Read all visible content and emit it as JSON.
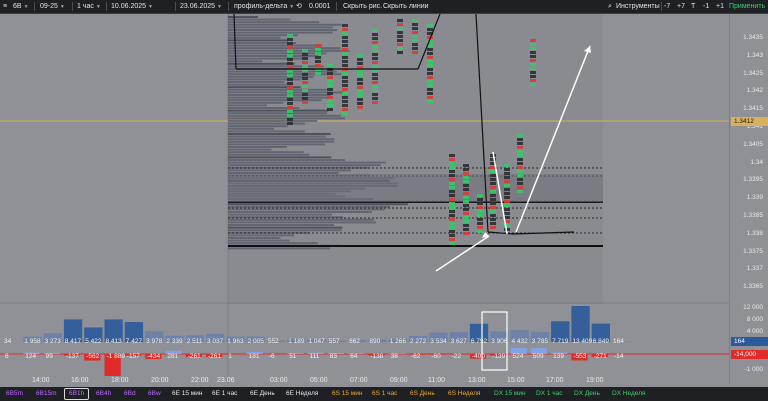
{
  "toolbar": {
    "symbol": "6B",
    "contract": "09-25",
    "interval": "1 час",
    "date_from": "10.06.2025",
    "date_to": "23.06.2025",
    "style": "профиль-дельта",
    "tick_size": "0.0001",
    "hide_levels": "Скрыть рис.",
    "hide_lines": "Скрыть линии",
    "instruments": "Инструменты",
    "minus7": "-7",
    "plus7": "+7",
    "t_btn": "T",
    "minus1": "-1",
    "plus1": "+1",
    "apply": "Применить",
    "menu_icon": "hamburger-icon",
    "search_icon": "search-icon",
    "refresh_icon": "refresh-icon"
  },
  "price_axis": {
    "ticks": [
      "1.3435",
      "1.343",
      "1.3425",
      "1.342",
      "1.3415",
      "1.341",
      "1.3405",
      "1.34",
      "1.3395",
      "1.339",
      "1.3385",
      "1.338",
      "1.3375",
      "1.337",
      "1.3365"
    ],
    "current_price": "1.3412",
    "volume_ticks": [
      "12 000",
      "8 000",
      "4 000"
    ],
    "volume_current": "164",
    "delta_ticks": [
      "1 000",
      "-1 000"
    ],
    "delta_current": "-14,000"
  },
  "volume_bars": {
    "values": [
      "34",
      "1 958",
      "3 273",
      "8 417",
      "5 422",
      "8 413",
      "7 427",
      "3 978",
      "2 339",
      "2 511",
      "3 037",
      "1 963",
      "2 005",
      "552",
      "1 189",
      "1 047",
      "557",
      "662",
      "890",
      "1 266",
      "2 272",
      "3 534",
      "3 627",
      "6 792",
      "3 906",
      "4 432",
      "3 785",
      "7 719",
      "13 409",
      "6 849",
      "164"
    ],
    "deltas": [
      "6",
      "124",
      "99",
      "-137",
      "-562",
      "-1 889",
      "-157",
      "-434",
      "281",
      "-261",
      "-261",
      "1",
      "181",
      "-6",
      "51",
      "111",
      "83",
      "64",
      "-138",
      "38",
      "-62",
      "-60",
      "-22",
      "-400",
      "-139",
      "524",
      "509",
      "139",
      "-553",
      "-271",
      "-14"
    ]
  },
  "time_axis": {
    "labels": [
      "14:00",
      "16:00",
      "18:00",
      "20:00",
      "22:00",
      "23.06",
      "03:00",
      "05:00",
      "07:00",
      "09:00",
      "11:00",
      "13:00",
      "15:00",
      "17:00",
      "19:00"
    ]
  },
  "bottom_tabs": [
    {
      "label": "6B5m",
      "color": "#c065ff"
    },
    {
      "label": "6B15m",
      "color": "#c065ff"
    },
    {
      "label": "6B1h",
      "color": "#c065ff",
      "active": true
    },
    {
      "label": "6B4h",
      "color": "#c065ff"
    },
    {
      "label": "6Bd",
      "color": "#c065ff"
    },
    {
      "label": "6Bw",
      "color": "#c065ff"
    },
    {
      "label": "6E 15 мин",
      "color": "#e6e6e6"
    },
    {
      "label": "6E 1 час",
      "color": "#e6e6e6"
    },
    {
      "label": "6E День",
      "color": "#e6e6e6"
    },
    {
      "label": "6E Неделя",
      "color": "#e6e6e6"
    },
    {
      "label": "6S 15 мин",
      "color": "#f0a830"
    },
    {
      "label": "6S 1 час",
      "color": "#f0a830"
    },
    {
      "label": "6S День",
      "color": "#f0a830"
    },
    {
      "label": "6S Неделя",
      "color": "#f0a830"
    },
    {
      "label": "DX 15 мин",
      "color": "#3fcf6a"
    },
    {
      "label": "DX 1 час",
      "color": "#3fcf6a"
    },
    {
      "label": "DX День",
      "color": "#3fcf6a"
    },
    {
      "label": "DX Неделя",
      "color": "#3fcf6a"
    }
  ],
  "colors": {
    "background": "#8f9196",
    "volume_bar": "#6a7fa8",
    "volume_bar_high": "#2a5a9a",
    "delta_negative": "#e02b2b",
    "delta_positive": "#7fa3e6",
    "price_line": "#d9b15a",
    "delta_zero_line": "#e02b2b",
    "up_candle": "#37c76a",
    "down_candle": "#d93b3b"
  }
}
